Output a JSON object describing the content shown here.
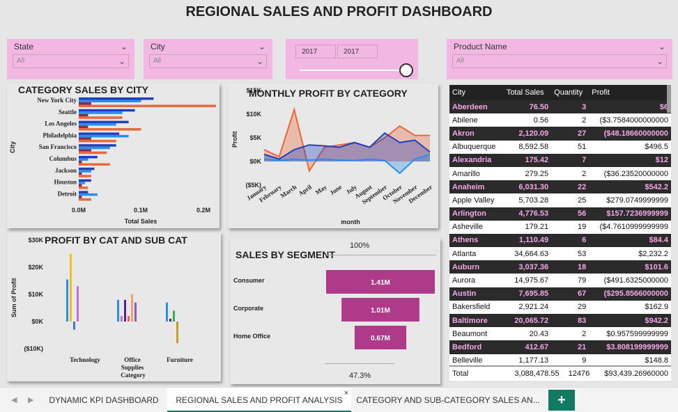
{
  "title": "REGIONAL SALES AND PROFIT DASHBOARD",
  "slicers": {
    "state": {
      "label": "State",
      "value": "All"
    },
    "city": {
      "label": "City",
      "value": "All"
    },
    "year": {
      "from": "2017",
      "to": "2017"
    },
    "product": {
      "label": "Product Name",
      "value": "All"
    }
  },
  "category_by_city": {
    "title": "CATEGORY SALES BY CITY",
    "xlabel": "Total Sales",
    "ylabel": "City",
    "ticks": [
      "0.0M",
      "0.1M",
      "0.2M"
    ]
  },
  "monthly_profit": {
    "title": "MONTHLY PROFIT BY CATEGORY",
    "xlabel": "month",
    "ylabel": "Profit",
    "ticks": [
      "$15K",
      "$10K",
      "$5K",
      "$0K",
      "($5K)"
    ]
  },
  "profit_cat_sub": {
    "title": "PROFIT BY CAT AND SUB CAT",
    "ylabel": "Sum of Profit",
    "xlabel": "Category",
    "ticks": [
      "$30K",
      "$20K",
      "$10K",
      "$0K",
      "($10K)"
    ]
  },
  "segment": {
    "title": "SALES BY SEGMENT",
    "top_pct": "100%",
    "bottom_pct": "47.3%",
    "bar_color": "#b03a8a"
  },
  "city_table": {
    "headers": [
      "City",
      "Total Sales",
      "Quantity",
      "Profit"
    ],
    "rows": [
      [
        "Aberdeen",
        "76.50",
        "3",
        "$6"
      ],
      [
        "Abilene",
        "0.56",
        "2",
        "($3.7584000000000"
      ],
      [
        "Akron",
        "2,120.09",
        "27",
        "($48.18660000000"
      ],
      [
        "Albuquerque",
        "8,592.58",
        "51",
        "$496.5"
      ],
      [
        "Alexandria",
        "175.42",
        "7",
        "$12"
      ],
      [
        "Amarillo",
        "279.25",
        "2",
        "($36.23520000000"
      ],
      [
        "Anaheim",
        "6,031.30",
        "22",
        "$542.2"
      ],
      [
        "Apple Valley",
        "5,703.28",
        "25",
        "$279.0749999999"
      ],
      [
        "Arlington",
        "4,776.53",
        "56",
        "$157.7236999999"
      ],
      [
        "Asheville",
        "179.21",
        "19",
        "($4.7610999999999"
      ],
      [
        "Athens",
        "1,110.49",
        "6",
        "$84.4"
      ],
      [
        "Atlanta",
        "34,664.63",
        "53",
        "$2,232.2"
      ],
      [
        "Auburn",
        "3,037.36",
        "18",
        "$101.6"
      ],
      [
        "Aurora",
        "14,975.67",
        "79",
        "($491.6325000000"
      ],
      [
        "Austin",
        "7,695.85",
        "67",
        "($295.8566000000"
      ],
      [
        "Bakersfield",
        "2,921.24",
        "29",
        "$162.9"
      ],
      [
        "Baltimore",
        "20,065.72",
        "83",
        "$942.2"
      ],
      [
        "Beaumont",
        "20.43",
        "2",
        "$0.957599999999"
      ],
      [
        "Bedford",
        "412.67",
        "21",
        "$3.808199999999"
      ],
      [
        "Belleville",
        "1,177.13",
        "9",
        "$148.8"
      ]
    ],
    "total": [
      "Total",
      "3,088,478.55",
      "12476",
      "$93,439.26960000"
    ]
  },
  "tabs": [
    "DYNAMIC KPI DASHBOARD",
    "REGIONAL SALES AND PROFIT ANALYSIS",
    "CATEGORY AND SUB-CATEGORY SALES AN...",
    "+"
  ],
  "chart_data": [
    {
      "type": "bar",
      "title": "CATEGORY SALES BY CITY",
      "orientation": "horizontal",
      "categories": [
        "New York City",
        "Seattle",
        "Los Angeles",
        "Philadelphia",
        "San Francisco",
        "Columbus",
        "Jackson",
        "Houston",
        "Detroit"
      ],
      "series": [
        {
          "color": "#1f3fbf",
          "values": [
            0.12,
            0.09,
            0.08,
            0.065,
            0.06,
            0.03,
            0.025,
            0.02,
            0.015
          ]
        },
        {
          "color": "#2b8fe8",
          "values": [
            0.1,
            0.07,
            0.06,
            0.08,
            0.05,
            0.015,
            0.02,
            0.01,
            0.03
          ]
        },
        {
          "color": "#8a2b4a",
          "values": [
            0.02,
            0.015,
            0.015,
            0.02,
            0.02,
            0.005,
            0.005,
            0.005,
            0.005
          ]
        },
        {
          "color": "#e8683a",
          "values": [
            0.22,
            0.07,
            0.1,
            0.06,
            0.045,
            0.05,
            0.02,
            0.015,
            0.02
          ]
        }
      ],
      "xlabel": "Total Sales",
      "ylabel": "City",
      "xlim": [
        0,
        0.22
      ]
    },
    {
      "type": "area",
      "title": "MONTHLY PROFIT BY CATEGORY",
      "x": [
        "January",
        "February",
        "March",
        "April",
        "May",
        "June",
        "July",
        "August",
        "September",
        "October",
        "November",
        "December"
      ],
      "series": [
        {
          "color": "#e8683a",
          "values": [
            2.5,
            1,
            11,
            -2,
            3,
            3.5,
            4,
            3,
            5,
            7.5,
            5.5,
            5.5
          ]
        },
        {
          "color": "#1f3fbf",
          "values": [
            1.5,
            0.5,
            2.5,
            3.5,
            3.3,
            3,
            4,
            3,
            6,
            4,
            4.5,
            2
          ]
        },
        {
          "color": "#2b8fe8",
          "values": [
            0.5,
            0.2,
            0.5,
            0.3,
            0.5,
            0.3,
            0.2,
            0.5,
            0.2,
            -2.5,
            0.5,
            1.5
          ]
        }
      ],
      "xlabel": "month",
      "ylabel": "Profit",
      "ylim": [
        -5,
        15
      ]
    },
    {
      "type": "bar",
      "title": "PROFIT BY CAT AND SUB CAT",
      "categories": [
        "Technology",
        "Office Supplies",
        "Furniture"
      ],
      "series": [
        {
          "color": "#2b8fe8",
          "values": [
            15.5,
            8,
            7
          ]
        },
        {
          "color": "#f0c020",
          "values": [
            25,
            0,
            0
          ]
        },
        {
          "color": "#4a6fe0",
          "values": [
            -3,
            0,
            0
          ]
        },
        {
          "color": "#c070d0",
          "values": [
            13,
            2,
            0
          ]
        },
        {
          "color": "#5a1f8a",
          "values": [
            0,
            8,
            1
          ]
        },
        {
          "color": "#e8683a",
          "values": [
            0,
            2,
            0
          ]
        },
        {
          "color": "#f0a070",
          "values": [
            0,
            10,
            0
          ]
        },
        {
          "color": "#8060c0",
          "values": [
            0,
            7,
            0
          ]
        },
        {
          "color": "#30b050",
          "values": [
            0,
            0,
            4
          ]
        },
        {
          "color": "#c8a020",
          "values": [
            0,
            0,
            -8
          ]
        }
      ],
      "ylabel": "Sum of Profit",
      "xlabel": "Category",
      "ylim": [
        -10,
        30
      ]
    },
    {
      "type": "bar",
      "title": "SALES BY SEGMENT",
      "categories": [
        "Consumer",
        "Corporate",
        "Home Office"
      ],
      "values": [
        1.41,
        1.01,
        0.67
      ],
      "labels": [
        "1.41M",
        "1.01M",
        "0.67M"
      ]
    }
  ]
}
